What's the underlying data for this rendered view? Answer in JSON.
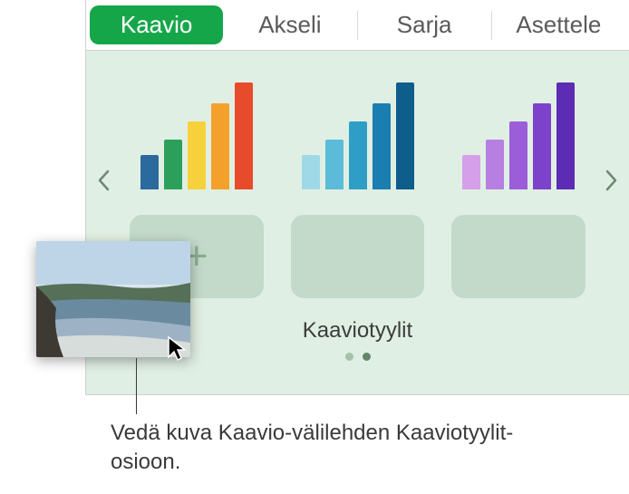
{
  "tabs": {
    "chart": "Kaavio",
    "axis": "Akseli",
    "series": "Sarja",
    "arrange": "Asettele"
  },
  "styles": {
    "label": "Kaaviotyylit"
  },
  "caption": {
    "text": "Vedä kuva Kaavio-välilehden Kaaviotyylit-osioon."
  },
  "chartThumbs": {
    "set1": [
      "#2b6a9d",
      "#2ca05a",
      "#f6d13b",
      "#f3a12a",
      "#e84b2c"
    ],
    "set2": [
      "#9fd9e8",
      "#5cbbd8",
      "#2f9ec7",
      "#1b7eb0",
      "#0f5d8a"
    ],
    "set3": [
      "#d59fea",
      "#b77fe2",
      "#9b5ed8",
      "#7c42cb",
      "#5c2cb5"
    ]
  }
}
